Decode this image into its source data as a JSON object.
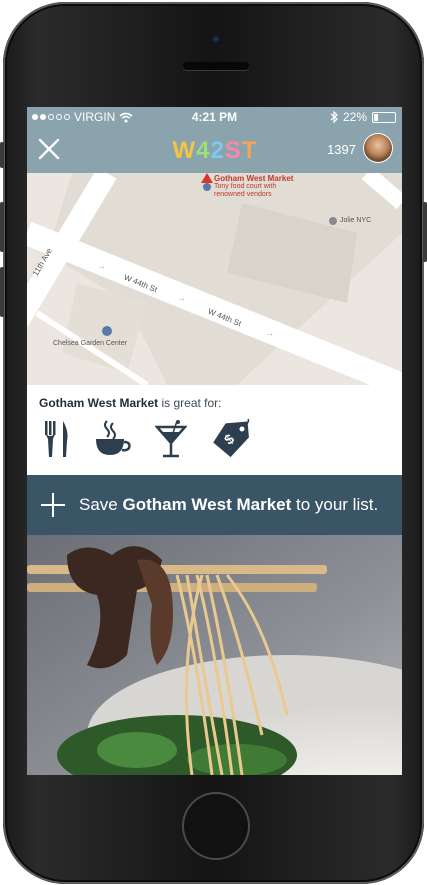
{
  "status_bar": {
    "carrier": "VIRGIN",
    "time": "4:21 PM",
    "battery": "22%",
    "battery_level": 0.22
  },
  "nav": {
    "logo": "W42ST",
    "points": "1397"
  },
  "map": {
    "place_name": "Gotham West Market",
    "place_desc_line1": "Tony food court with",
    "place_desc_line2": "renowned vendors",
    "poi_jolie": "Jolie NYC",
    "poi_chelsea": "Chelsea Garden Center",
    "street_11th": "11th Ave",
    "street_w44_a": "W 44th St",
    "street_w44_b": "W 44th St"
  },
  "great_for": {
    "name": "Gotham West Market",
    "suffix": " is great for:",
    "icons": [
      "fork-knife-icon",
      "coffee-cup-icon",
      "cocktail-icon",
      "price-tag-icon"
    ]
  },
  "save": {
    "prefix": "Save ",
    "name": "Gotham West Market",
    "suffix": " to your list."
  },
  "colors": {
    "header": "#8aa3ad",
    "save_bar": "#3a5566",
    "icon_dark": "#2d3e4e"
  }
}
